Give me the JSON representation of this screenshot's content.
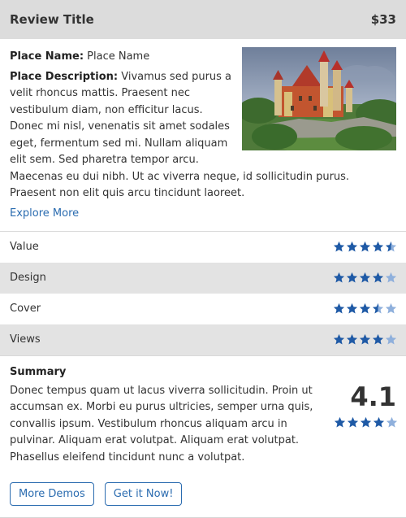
{
  "header": {
    "title": "Review Title",
    "price": "$33"
  },
  "place": {
    "name_label": "Place Name:",
    "name_value": "Place Name",
    "description_label": "Place Description:",
    "description_value": "Vivamus sed purus a velit rhoncus mattis. Praesent nec vestibulum diam, non efficitur lacus. Donec mi nisl, venenatis sit amet sodales eget, fermentum sed mi. Nullam aliquam elit sem. Sed pharetra tempor arcu. Maecenas eu dui nibh. Ut ac viverra neque, id sollicitudin purus. Praesent non elit quis arcu tincidunt laoreet.",
    "explore_link": "Explore More",
    "image_subject": "castle-photo"
  },
  "ratings": [
    {
      "label": "Value",
      "stars": 4.5
    },
    {
      "label": "Design",
      "stars": 4
    },
    {
      "label": "Cover",
      "stars": 3.5
    },
    {
      "label": "Views",
      "stars": 4
    }
  ],
  "summary": {
    "title": "Summary",
    "text": "Donec tempus quam ut lacus viverra sollicitudin. Proin ut accumsan ex. Morbi eu purus ultricies, semper urna quis, convallis ipsum. Vestibulum rhoncus aliquam arcu in pulvinar. Aliquam erat volutpat. Aliquam erat volutpat. Phasellus eleifend tincidunt nunc a volutpat.",
    "score": "4.1",
    "score_stars": 4
  },
  "buttons": {
    "more_demos": "More Demos",
    "get_it": "Get it Now!"
  },
  "colors": {
    "star_full": "#1f5aa6",
    "star_empty": "#8fb0dc",
    "link": "#2b6cb0",
    "header_bg": "#dcdcdc",
    "row_alt_bg": "#e3e3e3"
  }
}
